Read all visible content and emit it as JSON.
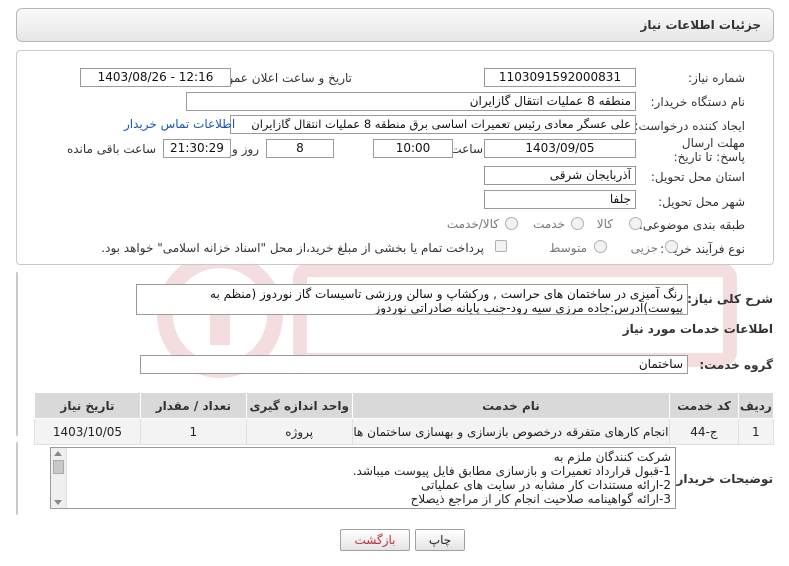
{
  "header": {
    "title": "جزئیات اطلاعات نیاز"
  },
  "need_number": {
    "label": "شماره نیاز:",
    "value": "1103091592000831"
  },
  "announce_datetime": {
    "label": "تاریخ و ساعت اعلان عمومی:",
    "value": "1403/08/26 - 12:16"
  },
  "buyer_org": {
    "label": "نام دستگاه خریدار:",
    "value": "منطقه 8 عملیات انتقال گازایران"
  },
  "requester": {
    "label": "ایجاد کننده درخواست:",
    "value": "علی عسگر معادی رئیس تعمیرات اساسی برق منطقه 8 عملیات انتقال گازایران",
    "contact_link": "اطلاعات تماس خریدار"
  },
  "deadline": {
    "label": "مهلت ارسال پاسخ: تا تاریخ:",
    "date": "1403/09/05",
    "time_label": "ساعت",
    "time": "10:00",
    "days": "8",
    "days_label": "روز و",
    "remaining": "21:30:29",
    "remaining_label": "ساعت باقی مانده"
  },
  "province": {
    "label": "استان محل تحویل:",
    "value": "آذربایجان شرقی"
  },
  "city": {
    "label": "شهر محل تحویل:",
    "value": "جلفا"
  },
  "category": {
    "label": "طبقه بندی موضوعی:",
    "options": [
      "کالا",
      "خدمت",
      "کالا/خدمت"
    ]
  },
  "process_type": {
    "label": "نوع فرآیند خرید :",
    "options": [
      "جزیی",
      "متوسط"
    ],
    "payment_note": "پرداخت تمام یا بخشی از مبلغ خرید،از محل \"اسناد خزانه اسلامی\" خواهد بود."
  },
  "summary": {
    "label": "شرح کلی نیاز:",
    "text": "رنگ آمیزی در ساختمان های حراست , ورکشاپ و سالن ورزشی تاسیسات گاز نوردوز (منظم به پیوست)آدرس:جاده مرزی سیه رود-جنب پایانه صادراتی نوردوز"
  },
  "services_info": {
    "title": "اطلاعات خدمات مورد نیاز"
  },
  "service_group": {
    "label": "گروه خدمت:",
    "value": "ساختمان"
  },
  "table": {
    "headers": [
      "ردیف",
      "کد خدمت",
      "نام خدمت",
      "واحد اندازه گیری",
      "تعداد / مقدار",
      "تاریخ نیاز"
    ],
    "rows": [
      [
        "1",
        "ج-44",
        "انجام کارهای متفرقه درخصوص بازسازی و بهسازی ساختمان ها",
        "پروژه",
        "1",
        "1403/10/05"
      ]
    ]
  },
  "buyer_notes": {
    "label": "توضیحات خریدار:",
    "lines": [
      "شرکت کنندگان ملزم به",
      "1-قبول قرارداد تعمیرات و بازسازی مطابق فایل پیوست میباشد.",
      "2-ارائه مستندات  کار مشابه در سایت های عملیاتی",
      "3-ارائه گواهینامه صلاحیت انجام کار از مراجع ذیصلاح"
    ]
  },
  "buttons": {
    "print": "چاپ",
    "back": "بازگشت"
  },
  "colors": {
    "back_button_text": "#c0303a",
    "link": "#1a55b5"
  }
}
